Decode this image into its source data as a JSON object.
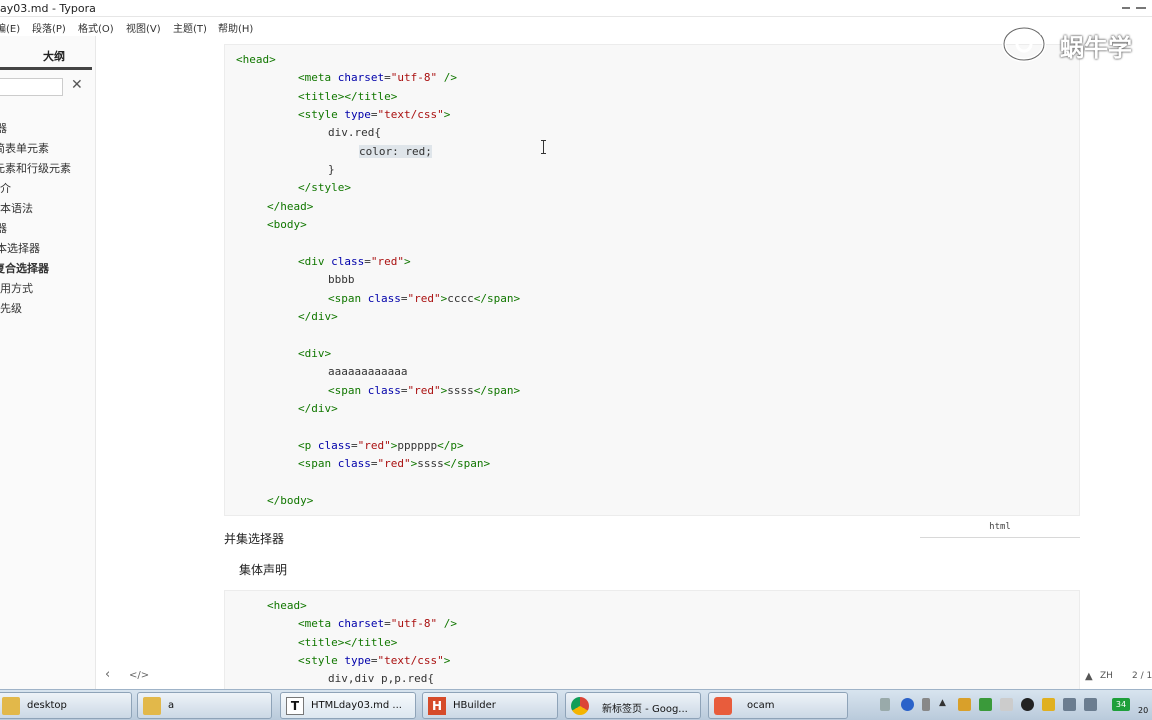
{
  "window": {
    "title": "ay03.md - Typora"
  },
  "menu": {
    "items": [
      "编(E)",
      "段落(P)",
      "格式(O)",
      "视图(V)",
      "主题(T)",
      "帮助(H)"
    ]
  },
  "sidebar": {
    "tab_label": "大纲",
    "search_value": "",
    "close_symbol": "✕",
    "items": [
      "器",
      "简表单元素",
      "元素和行级元素",
      "介",
      "本语法",
      "器",
      "本选择器",
      "复合选择器",
      "用方式",
      "先级"
    ],
    "bottom_left": "‹",
    "bottom_right": "</>"
  },
  "watermark": {
    "text": "蜗牛学"
  },
  "codeblock1": {
    "lines": [
      "<head>",
      "        <meta charset=\"utf-8\" />",
      "        <title></title>",
      "        <style type=\"text/css\">",
      "            div.red{",
      "                color: red;",
      "            }",
      "        </style>",
      "    </head>",
      "    <body>",
      "",
      "        <div class=\"red\">",
      "            bbbb",
      "            <span class=\"red\">cccc</span>",
      "        </div>",
      "",
      "        <div>",
      "            aaaaaaaaaaaa",
      "            <span class=\"red\">ssss</span>",
      "        </div>",
      "",
      "        <p class=\"red\">pppppp</p>",
      "        <span class=\"red\">ssss</span>",
      "",
      "    </body>"
    ],
    "language": "html"
  },
  "headings": {
    "union_selector": "并集选择器",
    "collective_declaration": "集体声明"
  },
  "codeblock2": {
    "lines": [
      "    <head>",
      "        <meta charset=\"utf-8\" />",
      "        <title></title>",
      "        <style type=\"text/css\">",
      "            div,div p,p.red{"
    ]
  },
  "statusbar": {
    "lang_indicator": "ZH",
    "page": "2 / 1"
  },
  "taskbar": {
    "tasks": [
      {
        "label": "desktop",
        "color": "#e2b84a"
      },
      {
        "label": "a",
        "color": "#e2b84a"
      },
      {
        "label": "HTMLday03.md ...",
        "color": "#ffffff"
      },
      {
        "label": "HBuilder",
        "color": "#d64b2a"
      },
      {
        "label": "新标签页 - Goog...",
        "color": "#3b8de0"
      },
      {
        "label": "ocam",
        "color": "#e85c3c"
      }
    ],
    "tray_badge": "34",
    "clock": "20"
  }
}
